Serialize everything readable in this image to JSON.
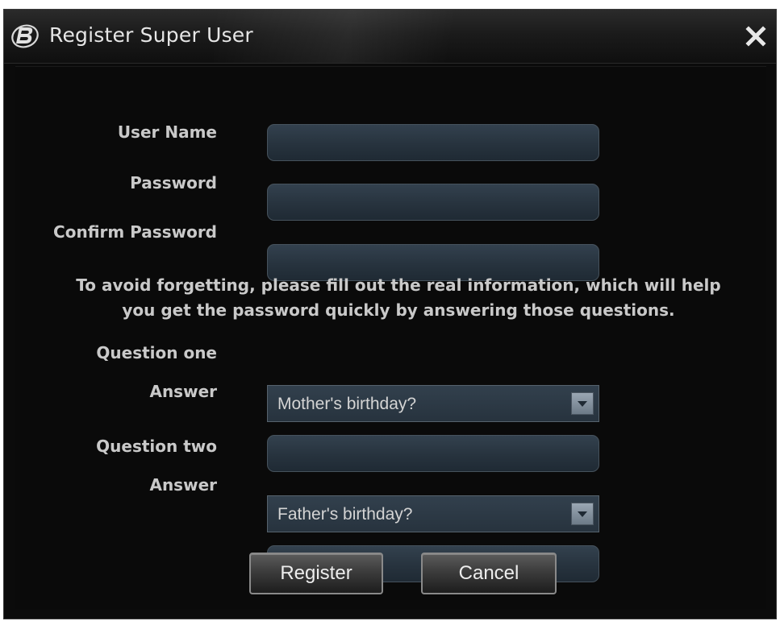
{
  "window": {
    "title": "Register Super User",
    "logo_icon": "app-logo-b-icon",
    "close_icon": "close-icon"
  },
  "form": {
    "user_name_label": "User Name",
    "user_name_value": "",
    "password_label": "Password",
    "password_value": "",
    "confirm_password_label": "Confirm Password",
    "confirm_password_value": "",
    "info_line1": "To avoid forgetting, please fill out the real information, which will help",
    "info_line2": "you get the password quickly by answering those questions.",
    "question_one_label": "Question one",
    "question_one_value": "Mother's birthday?",
    "answer_one_label": "Answer",
    "answer_one_value": "",
    "question_two_label": "Question two",
    "question_two_value": "Father's birthday?",
    "answer_two_label": "Answer",
    "answer_two_value": ""
  },
  "buttons": {
    "register": "Register",
    "cancel": "Cancel"
  },
  "colors": {
    "window_bg": "#0b0b0b",
    "field_bg": "#2c3844",
    "text": "#c9c9c9"
  }
}
